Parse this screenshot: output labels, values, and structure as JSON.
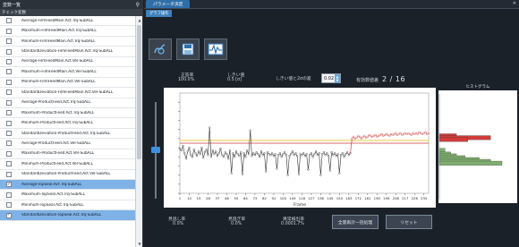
{
  "left_panel": {
    "title": "変数一覧",
    "pin_icon": "pin-icon",
    "col_check": "チェック",
    "col_var": "変数",
    "items": [
      {
        "label": "Average-FilmFeedMain.Act.Trq-SubALL",
        "checked": false,
        "selected": false
      },
      {
        "label": "Maximum-FilmFeedMain.Act.Trq-SubALL",
        "checked": false,
        "selected": false
      },
      {
        "label": "Minimum-FilmFeedMain.Act.Trq-SubALL",
        "checked": false,
        "selected": false
      },
      {
        "label": "StandardDeviation-FilmFeedMain.Act.Trq-SubALL",
        "checked": false,
        "selected": false
      },
      {
        "label": "Average-FilmFeedMain.Act.Vel-SubALL",
        "checked": false,
        "selected": false
      },
      {
        "label": "Maximum-FilmFeedMain.Act.Vel-SubALL",
        "checked": false,
        "selected": false
      },
      {
        "label": "Minimum-FilmFeedMain.Act.Vel-SubALL",
        "checked": false,
        "selected": false
      },
      {
        "label": "StandardDeviation-FilmFeedMain.Act.Vel-SubALL",
        "checked": false,
        "selected": false
      },
      {
        "label": "Average-ProductFeed.Act.Trq-SubALL",
        "checked": false,
        "selected": false
      },
      {
        "label": "Maximum-ProductFeed.Act.Trq-SubALL",
        "checked": false,
        "selected": false
      },
      {
        "label": "Minimum-ProductFeed.Act.Trq-SubALL",
        "checked": false,
        "selected": false
      },
      {
        "label": "StandardDeviation-ProductFeed.Act.Trq-SubALL",
        "checked": false,
        "selected": false
      },
      {
        "label": "Average-ProductFeed.Act.Vel-SubALL",
        "checked": false,
        "selected": false
      },
      {
        "label": "Maximum-ProductFeed.Act.Vel-SubALL",
        "checked": false,
        "selected": false
      },
      {
        "label": "Minimum-ProductFeed.Act.Vel-SubALL",
        "checked": false,
        "selected": false
      },
      {
        "label": "StandardDeviation-ProductFeed.Act.Vel-SubALL",
        "checked": false,
        "selected": false
      },
      {
        "label": "Average-TopSeal.Act.Trq-SubALL",
        "checked": true,
        "selected": true
      },
      {
        "label": "Maximum-TopSeal.Act.Trq-SubALL",
        "checked": false,
        "selected": false
      },
      {
        "label": "Minimum-TopSeal.Act.Trq-SubALL",
        "checked": false,
        "selected": false
      },
      {
        "label": "StandardDeviation-TopSeal.Act.Trq-SubALL",
        "checked": true,
        "selected": true
      }
    ]
  },
  "right_panel": {
    "tab_title": "パラメータ決定",
    "sub_tab": "グラフ操作",
    "tools": [
      "hand-pointer-icon",
      "save-icon",
      "waveform-icon"
    ],
    "stats": {
      "correct_rate_label": "正答率",
      "correct_rate_value": "100.0%",
      "threshold_label": "しきい値",
      "threshold_value": "0.5 [σ]",
      "multiple_label": "しきい値と2σの差",
      "multiple_value": "0.02",
      "valid_count_label": "有効数値差",
      "valid_count_value": "2 / 16"
    },
    "bottom": {
      "miss_label": "見逃し率",
      "miss_value": "0.0%",
      "overlook_label": "見過ぎ率",
      "overlook_value": "0.0%",
      "anomaly_label": "異常検出率",
      "anomaly_value": "0.0001.7%",
      "button_batch": "全量再計一括処理",
      "button_reset": "リセット"
    },
    "histogram_title": "ヒストグラム"
  },
  "chart_data": [
    {
      "type": "line",
      "title": "",
      "xlabel": "Frame",
      "ylabel": "",
      "xlim": [
        1,
        160
      ],
      "ylim": [
        0,
        1.1
      ],
      "x_ticks": [
        1,
        7,
        13,
        19,
        25,
        31,
        37,
        43,
        49,
        55,
        61,
        67,
        73,
        79,
        85,
        91,
        97,
        103,
        109,
        115,
        121,
        127,
        133,
        139,
        145,
        151,
        157
      ],
      "y_ticks": [
        0,
        0.1,
        0.2,
        0.3,
        0.4,
        0.5,
        0.6,
        0.7,
        0.8,
        0.9,
        1
      ],
      "x_tick_labels": [
        "1",
        "10",
        "19",
        "28",
        "37",
        "46",
        "55",
        "64",
        "73",
        "82",
        "91",
        "100",
        "109",
        "118",
        "127",
        "136",
        "145",
        "154",
        "163",
        "172",
        "181",
        "190",
        "199",
        "208",
        "217",
        "226",
        "235"
      ],
      "thresholds": [
        {
          "value": 0.58,
          "color": "#e8c020"
        },
        {
          "value": 0.55,
          "color": "#d03a3a"
        }
      ],
      "series": [
        {
          "color": "#ffffff",
          "marker_color": "#222222",
          "values": [
            0.49,
            0.47,
            0.52,
            0.44,
            0.38,
            0.46,
            0.5,
            0.42,
            0.4,
            0.48,
            0.44,
            0.41,
            0.46,
            0.43,
            0.5,
            0.39,
            0.45,
            0.48,
            0.42,
            0.44,
            0.4,
            0.47,
            0.43,
            0.46,
            0.41,
            0.44,
            0.49,
            0.42,
            0.4,
            0.45,
            0.43,
            0.38,
            0.47,
            0.42,
            0.44,
            0.4,
            0.46,
            0.43,
            0.41,
            0.45,
            0.42,
            0.44,
            0.4,
            0.47,
            0.43,
            0.46,
            0.41,
            0.44,
            0.42,
            0.45,
            0.43,
            0.4,
            0.46,
            0.42,
            0.44,
            0.41,
            0.45,
            0.43,
            0.42,
            0.44,
            0.41,
            0.43,
            0.45,
            0.42,
            0.44,
            0.4,
            0.43,
            0.45,
            0.42,
            0.44,
            0.41,
            0.43,
            0.46,
            0.42,
            0.44,
            0.41,
            0.45,
            0.43,
            0.42,
            0.44,
            0.41,
            0.43,
            0.45,
            0.42,
            0.44,
            0.4,
            0.43,
            0.46,
            0.42,
            0.44,
            0.41,
            0.43,
            0.45,
            0.42,
            0.44,
            0.41,
            0.43,
            0.45,
            0.42,
            0.44,
            0.41,
            0.43,
            0.45,
            0.42,
            0.44,
            0.4,
            0.43,
            0.45,
            0.42,
            0.44
          ]
        },
        {
          "color": "#d23b3b",
          "values": [
            0.6,
            0.62,
            0.6,
            0.61,
            0.63,
            0.62,
            0.6,
            0.62,
            0.63,
            0.61,
            0.62,
            0.64,
            0.63,
            0.62,
            0.63,
            0.64,
            0.62,
            0.63,
            0.64,
            0.65,
            0.63,
            0.64,
            0.65,
            0.64,
            0.63,
            0.65,
            0.64,
            0.65,
            0.66,
            0.64,
            0.65,
            0.66,
            0.64,
            0.65,
            0.66,
            0.65,
            0.66,
            0.65,
            0.64,
            0.66,
            0.65,
            0.66,
            0.65,
            0.67,
            0.66,
            0.65,
            0.66,
            0.67,
            0.65,
            0.66
          ]
        }
      ],
      "spikes": [
        {
          "x": 20,
          "y": 0.72
        },
        {
          "x": 34,
          "y": 0.22
        },
        {
          "x": 41,
          "y": 0.21
        },
        {
          "x": 46,
          "y": 0.69
        },
        {
          "x": 56,
          "y": 0.24
        },
        {
          "x": 63,
          "y": 0.27
        },
        {
          "x": 70,
          "y": 0.2
        },
        {
          "x": 77,
          "y": 0.21
        },
        {
          "x": 83,
          "y": 0.26
        },
        {
          "x": 91,
          "y": 0.2
        },
        {
          "x": 97,
          "y": 0.25
        },
        {
          "x": 103,
          "y": 0.22
        }
      ]
    },
    {
      "type": "bar",
      "title": "ヒストグラム",
      "orientation": "horizontal",
      "bins": [
        {
          "value": 0.66,
          "count": 6,
          "color": "#d23b3b"
        },
        {
          "value": 0.64,
          "count": 18,
          "color": "#d23b3b"
        },
        {
          "value": 0.62,
          "count": 10,
          "color": "#d23b3b"
        },
        {
          "value": 0.5,
          "count": 2,
          "color": "#7fae6f"
        },
        {
          "value": 0.46,
          "count": 4,
          "color": "#7fae6f"
        },
        {
          "value": 0.44,
          "count": 6,
          "color": "#7fae6f"
        },
        {
          "value": 0.42,
          "count": 9,
          "color": "#7fae6f"
        },
        {
          "value": 0.4,
          "count": 14,
          "color": "#7fae6f"
        },
        {
          "value": 0.38,
          "count": 18,
          "color": "#7fae6f"
        },
        {
          "value": 0.36,
          "count": 22,
          "color": "#7fae6f"
        }
      ]
    }
  ]
}
